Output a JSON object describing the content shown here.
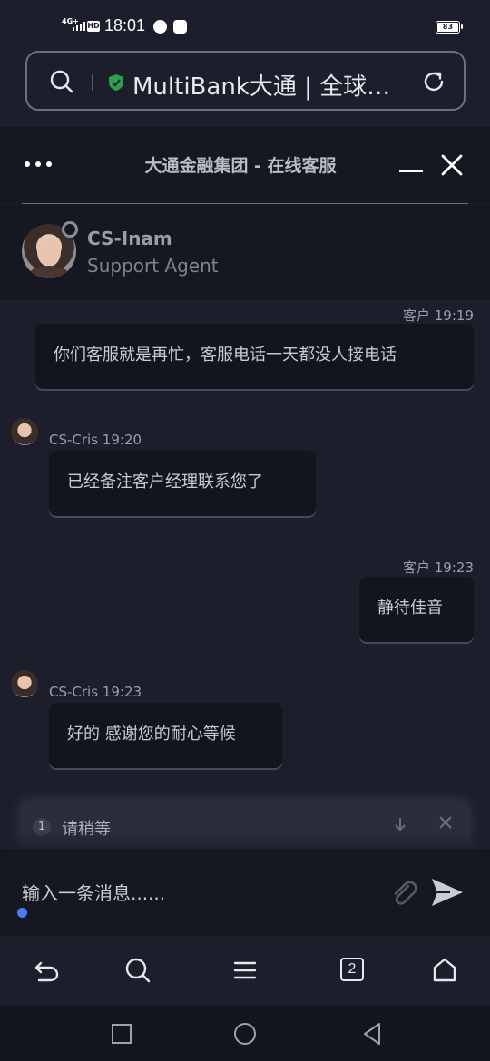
{
  "status_bar": {
    "network": "4G+",
    "hd_label": "HD",
    "time": "18:01",
    "battery": "83"
  },
  "browser": {
    "url_text": "MultiBank大通 | 全球…",
    "tab_count": "2"
  },
  "chat": {
    "header_title": "大通金融集团 - 在线客服",
    "agent_name": "CS-Inam",
    "agent_role": "Support Agent",
    "messages": [
      {
        "sender": "客户",
        "time": "19:19",
        "meta": "客户 19:19",
        "text": "你们客服就是再忙，客服电话一天都没人接电话",
        "side": "right"
      },
      {
        "sender": "CS-Cris",
        "time": "19:20",
        "meta": "CS-Cris 19:20",
        "text": "已经备注客户经理联系您了",
        "side": "left"
      },
      {
        "sender": "客户",
        "time": "19:23",
        "meta": "客户 19:23",
        "text": "静待佳音",
        "side": "right"
      },
      {
        "sender": "CS-Cris",
        "time": "19:23",
        "meta": "CS-Cris 19:23",
        "text": "好的 感谢您的耐心等候",
        "side": "left"
      }
    ],
    "quick_reply": {
      "number": "1",
      "text": "请稍等"
    },
    "input": {
      "placeholder": "输入一条消息......"
    }
  },
  "icons": {
    "url_bar": [
      "search-icon",
      "shield-check-icon",
      "reload-icon"
    ],
    "header": [
      "more-dots-icon",
      "minimize-icon",
      "close-icon"
    ],
    "input": [
      "paperclip-icon",
      "send-icon"
    ],
    "toolbar": [
      "back-icon",
      "search-icon",
      "menu-icon",
      "tabs-icon",
      "home-icon"
    ],
    "system_nav": [
      "recents-icon",
      "home-circle-icon",
      "back-triangle-icon"
    ]
  },
  "colors": {
    "background": "#1c1f2b",
    "header_background": "#151821",
    "bubble_background": "#12151e",
    "accent_blue": "#4b7cf3",
    "shield_green": "#2e9e4f"
  }
}
